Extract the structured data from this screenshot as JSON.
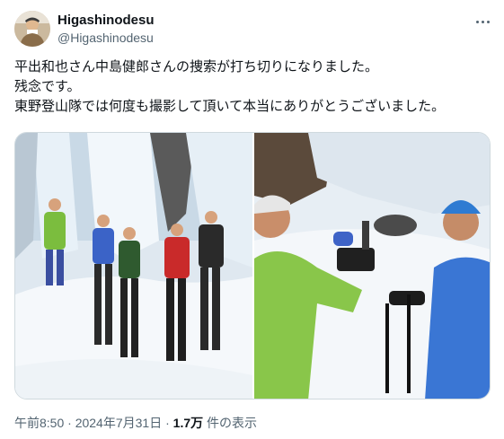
{
  "author": {
    "display_name": "Higashinodesu",
    "handle": "@Higashinodesu"
  },
  "tweet": {
    "lines": [
      "平出和也さん中島健郎さんの捜索が打ち切りになりました。",
      "残念です。",
      "東野登山隊では何度も撮影して頂いて本当にありがとうございました。"
    ]
  },
  "media": {
    "count": 2,
    "items": [
      {
        "kind": "photo",
        "subject": "group-of-climbers-at-frozen-waterfall"
      },
      {
        "kind": "photo",
        "subject": "interview-with-camera-in-snow"
      }
    ]
  },
  "meta": {
    "time": "午前8:50",
    "separator": "·",
    "date": "2024年7月31日",
    "views_count": "1.7万",
    "views_label": "件の表示"
  },
  "icons": {
    "more": "more-horizontal-icon"
  },
  "colors": {
    "text_primary": "#0f1419",
    "text_secondary": "#536471",
    "border": "#cfd9de"
  }
}
